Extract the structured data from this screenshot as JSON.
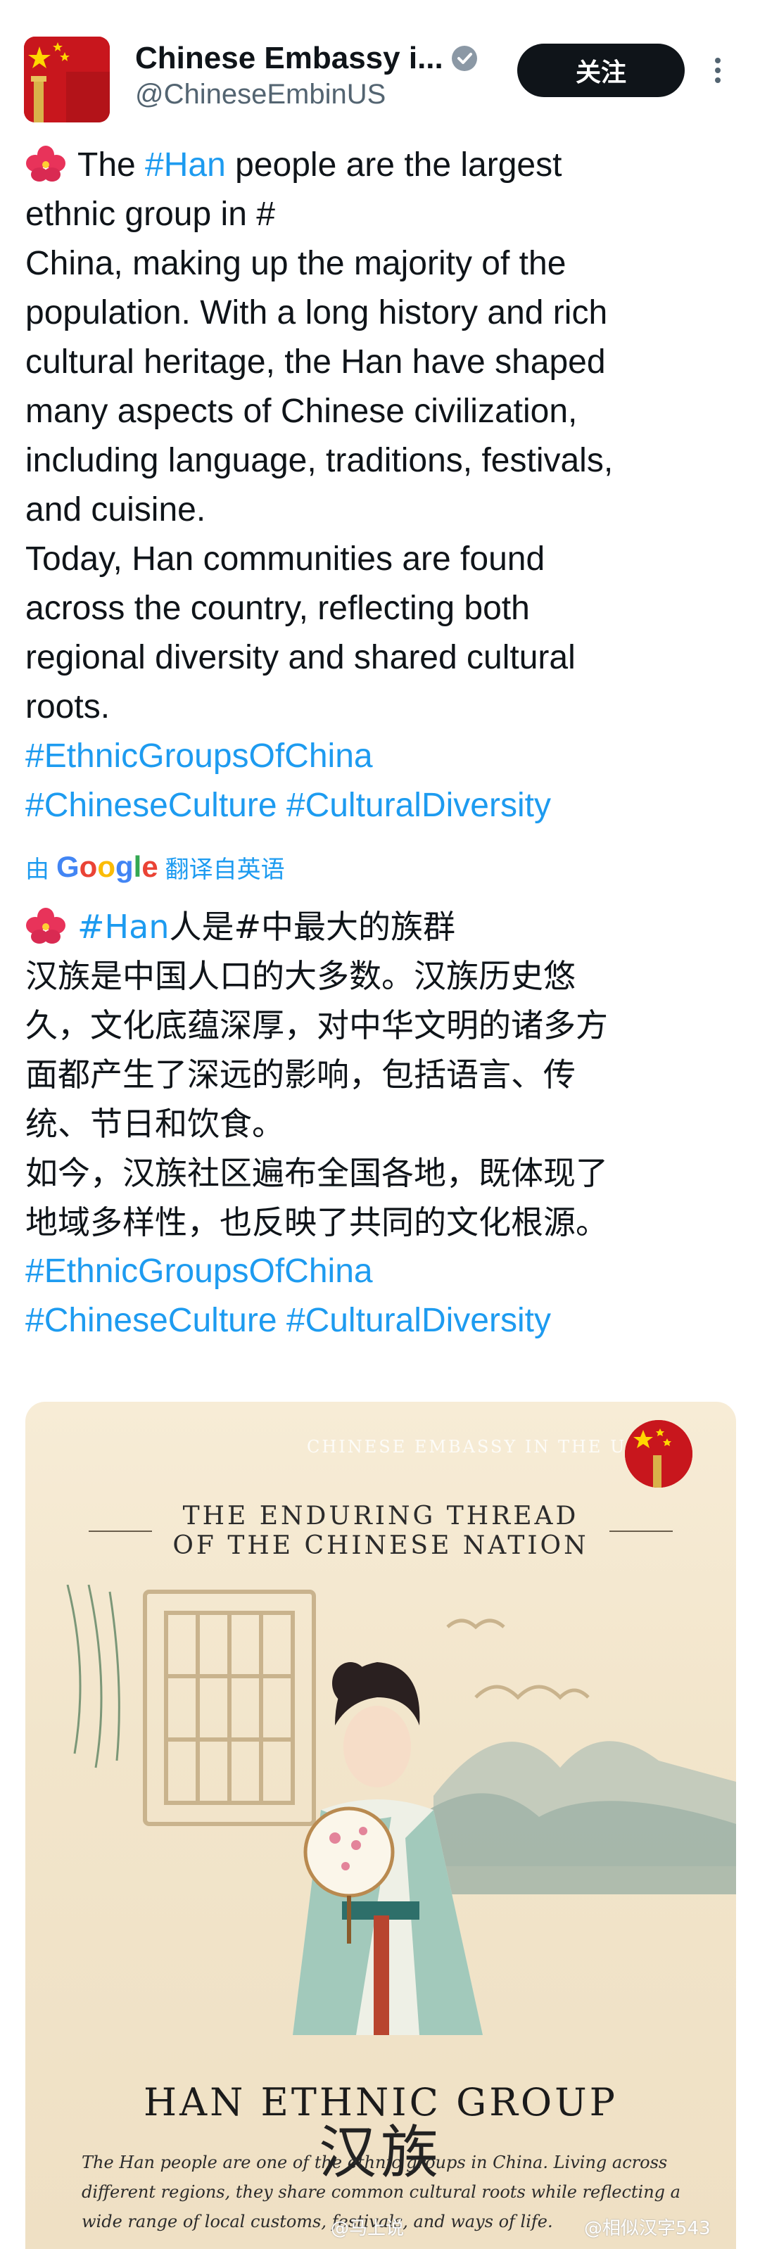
{
  "account": {
    "display_name": "Chinese Embassy i...",
    "handle": "@ChineseEmbinUS",
    "follow_label": "关注"
  },
  "post_en": {
    "lines": [
      {
        "pre": "The ",
        "tag": "#Han",
        "post": " people are the largest"
      },
      {
        "pre": "ethnic group in #",
        "tag": "",
        "post": ""
      },
      {
        "pre": "China, making up the majority of the",
        "tag": "",
        "post": ""
      },
      {
        "pre": "population. With a long history and rich",
        "tag": "",
        "post": ""
      },
      {
        "pre": "cultural heritage, the Han have shaped",
        "tag": "",
        "post": ""
      },
      {
        "pre": "many aspects of Chinese civilization,",
        "tag": "",
        "post": ""
      },
      {
        "pre": "including language, traditions, festivals,",
        "tag": "",
        "post": ""
      },
      {
        "pre": "and cuisine.",
        "tag": "",
        "post": ""
      },
      {
        "pre": "Today, Han communities are found",
        "tag": "",
        "post": ""
      },
      {
        "pre": "across the country, reflecting both",
        "tag": "",
        "post": ""
      },
      {
        "pre": "regional diversity and shared cultural",
        "tag": "",
        "post": ""
      },
      {
        "pre": "roots.",
        "tag": "",
        "post": ""
      }
    ],
    "hashtags_line1": "#EthnicGroupsOfChina",
    "hashtags_line2": "#ChineseCulture #CulturalDiversity"
  },
  "translation": {
    "prefix": "由",
    "brand": "Google",
    "suffix": "翻译自英语"
  },
  "post_zh": {
    "first_tag": "#Han",
    "first_rest": "人是#中最大的族群",
    "lines": [
      "汉族是中国人口的大多数。汉族历史悠",
      "久，文化底蕴深厚，对中华文明的诸多方",
      "面都产生了深远的影响，包括语言、传",
      "统、节日和饮食。",
      "如今，汉族社区遍布全国各地，既体现了",
      "地域多样性，也反映了共同的文化根源。"
    ],
    "hashtags_line1": "#EthnicGroupsOfChina",
    "hashtags_line2": "#ChineseCulture #CulturalDiversity"
  },
  "card": {
    "badge": "CHINESE EMBASSY IN THE U.S",
    "title_line1": "THE ENDURING THREAD",
    "title_line2": "OF THE CHINESE NATION",
    "calligraphy": "汉族",
    "main_title": "HAN ETHNIC GROUP",
    "desc_lines": [
      "The Han people are one of the ethnic groups in China. Living across",
      "different regions, they share common cultural roots while reflecting a",
      "wide range of local customs, festivals, and ways of life."
    ]
  },
  "watermarks": {
    "left": "@马上说",
    "right": "@相似汉字543"
  },
  "colors": {
    "link": "#1d9bf0",
    "text": "#0f1419",
    "muted": "#536471",
    "follow_bg": "#0f1419",
    "flag_red": "#c8161d",
    "flag_gold": "#ffd700"
  }
}
